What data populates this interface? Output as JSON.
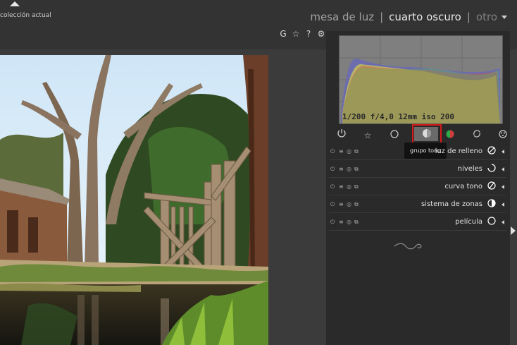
{
  "header": {
    "collection_label": "colección actual",
    "views": [
      "mesa de luz",
      "cuarto oscuro",
      "otro"
    ],
    "separator": "|",
    "quick_icons": {
      "grouping": "G",
      "star": "☆",
      "help": "?",
      "gear": "⚙"
    }
  },
  "histogram": {
    "exposure_info": "1/200 f/4,0 12mm iso 200"
  },
  "module_groups": {
    "tabs": [
      "power-icon",
      "star-icon",
      "circle-icon",
      "tone-group-icon",
      "color-group-icon",
      "correction-icon",
      "effect-icon"
    ],
    "active_tab": "tone-group-icon",
    "tooltip": "grupo tono"
  },
  "modules": [
    {
      "name": "luz de relleno",
      "icon": "fill-light-icon"
    },
    {
      "name": "niveles",
      "icon": "levels-icon"
    },
    {
      "name": "curva tono",
      "icon": "tone-curve-icon"
    },
    {
      "name": "sistema de zonas",
      "icon": "zone-system-icon"
    },
    {
      "name": "película",
      "icon": "film-icon"
    }
  ],
  "colors": {
    "accent_highlight": "#d61a1a",
    "panel_bg": "#2a2a2a",
    "top_bg": "#333333"
  }
}
